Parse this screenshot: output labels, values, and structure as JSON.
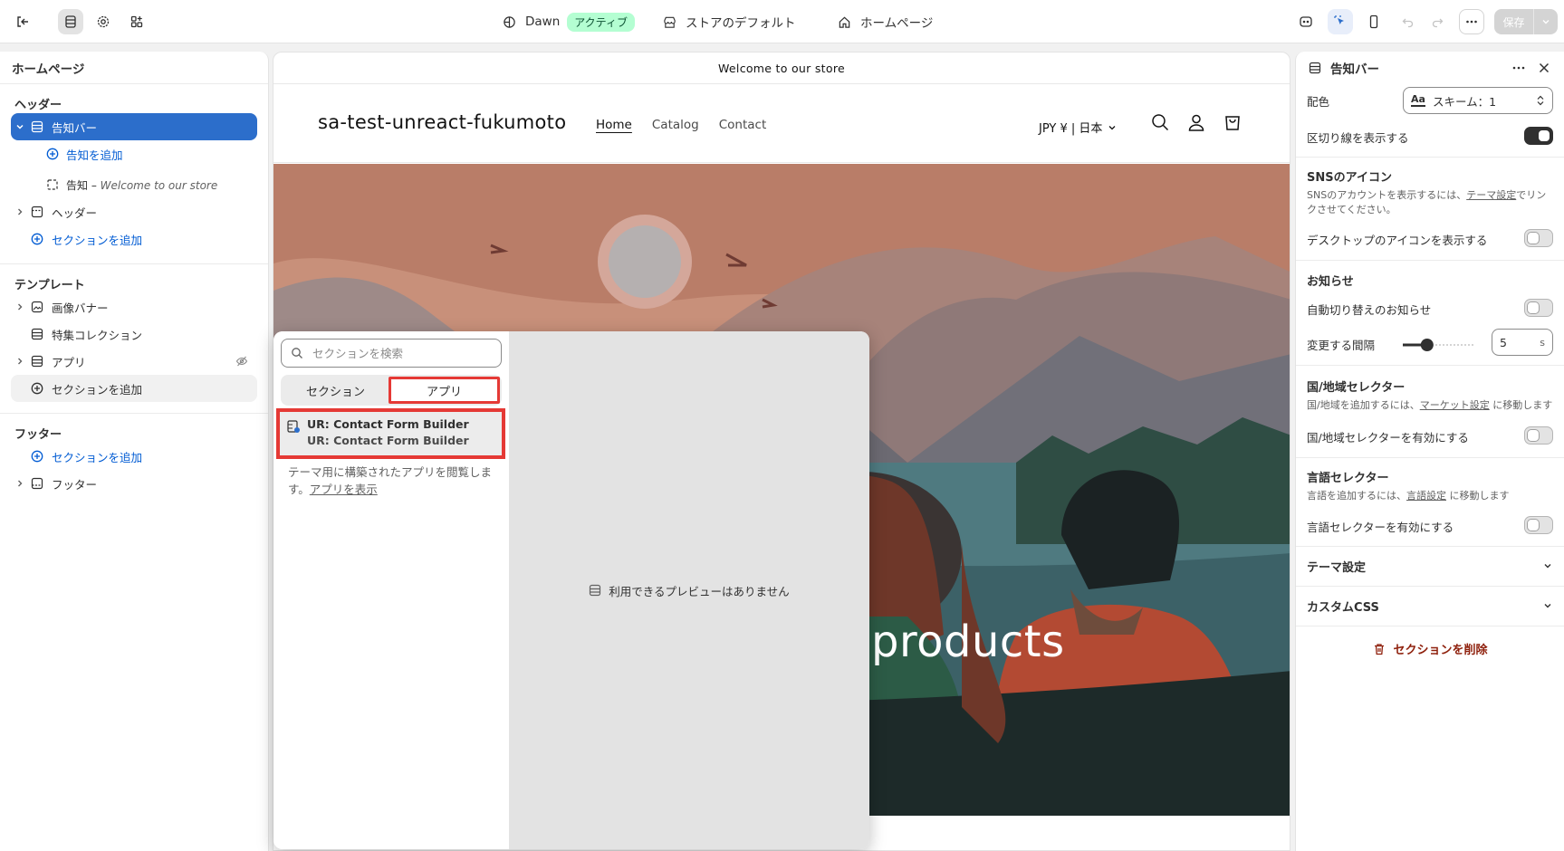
{
  "topbar": {
    "theme_name": "Dawn",
    "theme_badge": "アクティブ",
    "store_default": "ストアのデフォルト",
    "page": "ホームページ",
    "save_label": "保存"
  },
  "left": {
    "title": "ホームページ",
    "header_section": "ヘッダー",
    "announcement_bar": "告知バー",
    "add_announcement": "告知を追加",
    "announcement_prefix": "告知 –",
    "announcement_text": "Welcome to our store",
    "header_item": "ヘッダー",
    "add_section_1": "セクションを追加",
    "template_section": "テンプレート",
    "image_banner": "画像バナー",
    "featured_collection": "特集コレクション",
    "apps": "アプリ",
    "add_section_2": "セクションを追加",
    "footer_section": "フッター",
    "add_section_3": "セクションを追加",
    "footer_item": "フッター"
  },
  "preview": {
    "announcement": "Welcome to our store",
    "store_name": "sa-test-unreact-fukumoto",
    "nav": [
      "Home",
      "Catalog",
      "Contact"
    ],
    "currency": "JPY ¥ | 日本",
    "hero_text": "products"
  },
  "popover": {
    "search_placeholder": "セクションを検索",
    "tab_sections": "セクション",
    "tab_apps": "アプリ",
    "app_title": "UR: Contact Form Builder",
    "app_subtitle": "UR: Contact Form Builder",
    "desc": "テーマ用に構築されたアプリを閲覧します。",
    "desc_link": "アプリを表示",
    "no_preview": "利用できるプレビューはありません"
  },
  "right": {
    "title": "告知バー",
    "color_label": "配色",
    "color_value": "スキーム：1",
    "divider_label": "区切り線を表示する",
    "sns_title": "SNSのアイコン",
    "sns_help_1": "SNSのアカウントを表示するには、",
    "sns_help_link": "テーマ設定",
    "sns_help_2": "でリンクさせてください。",
    "sns_desktop": "デスクトップのアイコンを表示する",
    "news_title": "お知らせ",
    "auto_rotate": "自動切り替えのお知らせ",
    "interval_label": "変更する間隔",
    "interval_value": "5",
    "interval_unit": "s",
    "interval_fraction": 0.3,
    "country_title": "国/地域セレクター",
    "country_help_1": "国/地域を追加するには、",
    "country_help_link": "マーケット設定",
    "country_help_2": "に移動します",
    "country_enable": "国/地域セレクターを有効にする",
    "lang_title": "言語セレクター",
    "lang_help_1": "言語を追加するには、",
    "lang_help_link": "言語設定",
    "lang_help_2": "に移動します",
    "lang_enable": "言語セレクターを有効にする",
    "theme_settings": "テーマ設定",
    "custom_css": "カスタムCSS",
    "delete_section": "セクションを削除"
  },
  "colors": {
    "selected_blue": "#2c6ecb",
    "link_blue": "#005bd3",
    "highlight_red": "#e53935",
    "delete_red": "#8e1f0b"
  }
}
